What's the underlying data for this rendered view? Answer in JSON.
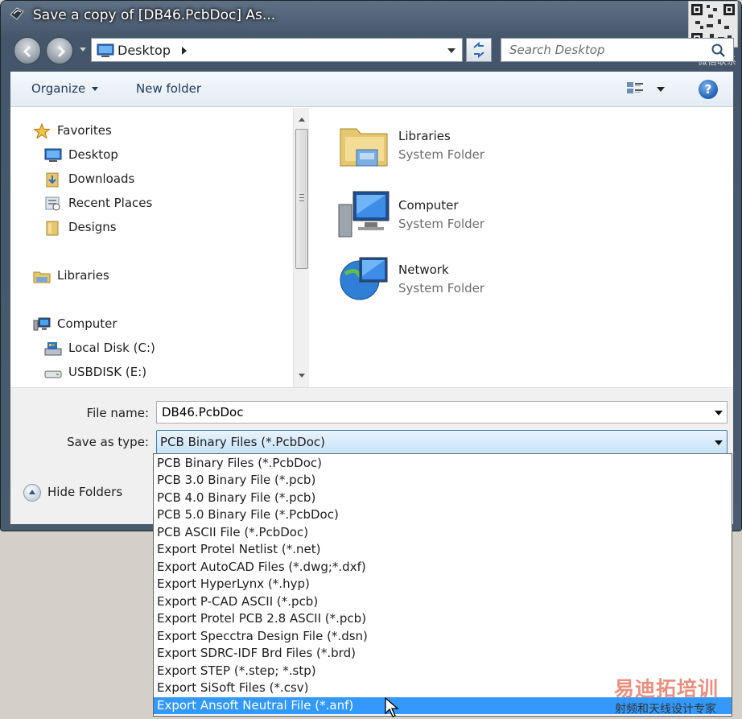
{
  "window": {
    "title": "Save a copy of [DB46.PcbDoc] As..."
  },
  "watermark": {
    "qr_caption": "微信联系",
    "brand": "易迪拓培训",
    "tagline": "射频和天线设计专家"
  },
  "address": {
    "location": "Desktop",
    "search_placeholder": "Search Desktop"
  },
  "toolbar": {
    "organize_label": "Organize",
    "new_folder_label": "New folder",
    "help_symbol": "?"
  },
  "navigation": {
    "favorites": "Favorites",
    "desktop": "Desktop",
    "downloads": "Downloads",
    "recent_places": "Recent Places",
    "designs": "Designs",
    "libraries": "Libraries",
    "computer": "Computer",
    "local_disk": "Local Disk (C:)",
    "usbdisk": "USBDISK (E:)"
  },
  "content": {
    "items": [
      {
        "name": "Libraries",
        "type": "System Folder",
        "icon": "libraries-icon"
      },
      {
        "name": "Computer",
        "type": "System Folder",
        "icon": "computer-icon"
      },
      {
        "name": "Network",
        "type": "System Folder",
        "icon": "network-icon"
      }
    ]
  },
  "form": {
    "file_name_label": "File name:",
    "file_name_value": "DB46.PcbDoc",
    "save_type_label": "Save as type:",
    "save_type_value": "PCB Binary Files (*.PcbDoc)",
    "hide_folders_label": "Hide Folders"
  },
  "save_type_options": [
    "PCB Binary Files (*.PcbDoc)",
    "PCB 3.0 Binary File (*.pcb)",
    "PCB 4.0 Binary File (*.pcb)",
    "PCB 5.0 Binary File (*.PcbDoc)",
    "PCB ASCII File (*.PcbDoc)",
    "Export Protel Netlist (*.net)",
    "Export AutoCAD Files (*.dwg;*.dxf)",
    "Export HyperLynx (*.hyp)",
    "Export P-CAD ASCII (*.pcb)",
    "Export Protel PCB 2.8 ASCII (*.pcb)",
    "Export Specctra Design File (*.dsn)",
    "Export SDRC-IDF Brd Files (*.brd)",
    "Export STEP (*.step; *.stp)",
    "Export SiSoft Files (*.csv)",
    "Export Ansoft Neutral File (*.anf)"
  ],
  "highlighted_option_index": 14,
  "colors": {
    "selection": "#3399ff",
    "frame": "#4a5b6e"
  }
}
